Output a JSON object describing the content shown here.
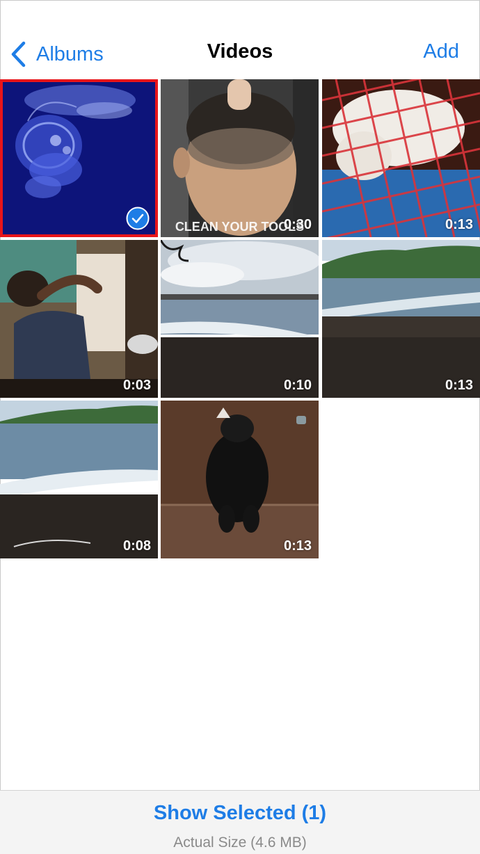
{
  "nav": {
    "back_label": "Albums",
    "title": "Videos",
    "add_label": "Add"
  },
  "videos": [
    {
      "duration": "",
      "selected": true,
      "subject": "jellyfish"
    },
    {
      "duration": "0:30",
      "selected": false,
      "subject": "haircut",
      "overlay_text": "CLEAN YOUR TOOLS"
    },
    {
      "duration": "0:13",
      "selected": false,
      "subject": "dog-in-cage"
    },
    {
      "duration": "0:03",
      "selected": false,
      "subject": "person-stretching"
    },
    {
      "duration": "0:10",
      "selected": false,
      "subject": "pier-beach"
    },
    {
      "duration": "0:13",
      "selected": false,
      "subject": "beach-shore"
    },
    {
      "duration": "0:08",
      "selected": false,
      "subject": "beach-waves"
    },
    {
      "duration": "0:13",
      "selected": false,
      "subject": "black-dog"
    }
  ],
  "toolbar": {
    "show_selected_label": "Show Selected (1)",
    "actual_size_label": "Actual Size (4.6 MB)"
  },
  "colors": {
    "accent": "#1e7de6",
    "selection_outline": "#e8151a",
    "toolbar_bg": "#f4f4f4"
  },
  "icons": [
    "chevron-left-icon",
    "checkmark-circle-icon"
  ]
}
